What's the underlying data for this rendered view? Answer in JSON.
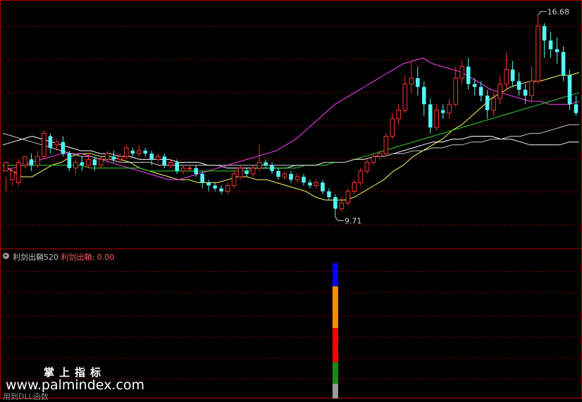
{
  "chart_data": {
    "type": "candlestick",
    "price_min_label": "9.71",
    "price_max_label": "16.68",
    "price_min": 9.71,
    "price_max": 16.68,
    "ylim": [
      8.7,
      17.1
    ],
    "candles": [
      [
        11.3,
        11.6,
        11.1,
        10.6
      ],
      [
        11.0,
        11.3,
        10.9,
        10.8
      ],
      [
        10.9,
        11.6,
        11.7,
        10.8
      ],
      [
        11.5,
        11.8,
        11.8,
        11.4
      ],
      [
        11.7,
        11.5,
        11.9,
        11.3
      ],
      [
        11.5,
        11.8,
        12.0,
        11.4
      ],
      [
        11.8,
        12.6,
        12.7,
        11.7
      ],
      [
        12.5,
        12.1,
        12.6,
        11.9
      ],
      [
        12.2,
        12.3,
        12.4,
        12.0
      ],
      [
        12.3,
        11.9,
        12.5,
        11.8
      ],
      [
        11.9,
        11.4,
        12.0,
        11.3
      ],
      [
        11.4,
        11.6,
        11.7,
        11.2
      ],
      [
        11.6,
        11.5,
        11.8,
        11.3
      ],
      [
        11.5,
        11.7,
        11.9,
        11.4
      ],
      [
        11.7,
        11.5,
        11.8,
        11.3
      ],
      [
        11.5,
        11.7,
        11.8,
        11.4
      ],
      [
        11.7,
        11.9,
        12.0,
        11.6
      ],
      [
        11.8,
        11.7,
        12.0,
        11.6
      ],
      [
        11.7,
        11.8,
        11.9,
        11.6
      ],
      [
        11.8,
        12.1,
        12.2,
        11.7
      ],
      [
        12.0,
        11.9,
        12.1,
        11.8
      ],
      [
        11.9,
        12.0,
        12.2,
        11.8
      ],
      [
        12.0,
        11.9,
        12.1,
        11.8
      ],
      [
        11.9,
        11.7,
        12.0,
        11.5
      ],
      [
        11.7,
        11.8,
        11.9,
        11.6
      ],
      [
        11.8,
        11.5,
        11.9,
        11.4
      ],
      [
        11.5,
        11.6,
        11.7,
        11.4
      ],
      [
        11.6,
        11.3,
        11.7,
        11.2
      ],
      [
        11.3,
        11.4,
        11.5,
        11.2
      ],
      [
        11.4,
        11.4,
        11.5,
        11.3
      ],
      [
        11.4,
        11.2,
        11.5,
        11.1
      ],
      [
        11.2,
        10.9,
        11.3,
        10.7
      ],
      [
        10.9,
        10.8,
        11.0,
        10.6
      ],
      [
        10.8,
        10.7,
        10.9,
        10.6
      ],
      [
        10.7,
        10.6,
        10.8,
        10.5
      ],
      [
        10.6,
        10.8,
        10.9,
        10.5
      ],
      [
        10.8,
        11.2,
        11.3,
        10.7
      ],
      [
        11.1,
        11.4,
        11.5,
        11.0
      ],
      [
        11.3,
        11.2,
        11.4,
        11.1
      ],
      [
        11.2,
        11.4,
        11.5,
        11.1
      ],
      [
        11.4,
        11.6,
        12.2,
        11.3
      ],
      [
        11.6,
        11.5,
        11.7,
        11.4
      ],
      [
        11.5,
        11.3,
        11.6,
        11.2
      ],
      [
        11.3,
        11.1,
        11.4,
        11.0
      ],
      [
        11.1,
        11.2,
        11.3,
        11.0
      ],
      [
        11.2,
        11.0,
        11.3,
        10.9
      ],
      [
        11.0,
        11.1,
        11.2,
        10.9
      ],
      [
        11.1,
        10.9,
        11.2,
        10.8
      ],
      [
        10.9,
        10.8,
        11.0,
        10.7
      ],
      [
        10.8,
        10.9,
        11.0,
        10.7
      ],
      [
        10.9,
        10.6,
        11.0,
        10.5
      ],
      [
        10.6,
        10.4,
        10.7,
        10.3
      ],
      [
        10.4,
        10.0,
        10.5,
        9.71
      ],
      [
        10.0,
        10.2,
        10.4,
        9.9
      ],
      [
        10.2,
        10.6,
        10.7,
        10.1
      ],
      [
        10.6,
        10.9,
        11.0,
        10.5
      ],
      [
        10.9,
        11.3,
        11.4,
        10.8
      ],
      [
        11.3,
        11.6,
        11.7,
        11.2
      ],
      [
        11.6,
        11.8,
        11.9,
        11.5
      ],
      [
        11.8,
        11.9,
        12.0,
        11.7
      ],
      [
        11.9,
        12.5,
        12.6,
        11.8
      ],
      [
        12.5,
        13.1,
        13.3,
        12.4
      ],
      [
        13.1,
        13.4,
        13.6,
        12.9
      ],
      [
        13.4,
        14.3,
        14.6,
        13.3
      ],
      [
        14.3,
        14.5,
        15.1,
        14.0
      ],
      [
        14.5,
        14.2,
        14.9,
        13.9
      ],
      [
        14.2,
        13.6,
        14.4,
        13.2
      ],
      [
        13.6,
        12.8,
        13.8,
        12.6
      ],
      [
        12.8,
        13.4,
        13.6,
        12.7
      ],
      [
        13.4,
        13.3,
        13.6,
        13.1
      ],
      [
        13.3,
        13.6,
        13.8,
        13.1
      ],
      [
        13.6,
        14.5,
        14.9,
        13.5
      ],
      [
        14.5,
        14.9,
        15.1,
        14.3
      ],
      [
        14.9,
        14.3,
        15.2,
        14.1
      ],
      [
        14.3,
        14.2,
        14.5,
        13.9
      ],
      [
        14.2,
        13.9,
        14.4,
        13.7
      ],
      [
        13.9,
        13.4,
        14.1,
        13.1
      ],
      [
        13.4,
        13.8,
        14.0,
        13.2
      ],
      [
        13.8,
        14.3,
        14.6,
        13.6
      ],
      [
        14.3,
        14.8,
        15.4,
        14.1
      ],
      [
        14.8,
        14.4,
        15.1,
        14.2
      ],
      [
        14.4,
        14.1,
        14.7,
        13.9
      ],
      [
        14.1,
        13.9,
        14.3,
        13.6
      ],
      [
        13.9,
        14.4,
        14.9,
        13.7
      ],
      [
        14.4,
        16.3,
        16.68,
        14.3
      ],
      [
        16.3,
        15.8,
        16.4,
        15.2
      ],
      [
        15.8,
        15.5,
        16.1,
        15.2
      ],
      [
        15.5,
        15.4,
        15.9,
        15.0
      ],
      [
        15.4,
        14.6,
        15.6,
        14.4
      ],
      [
        14.6,
        13.6,
        14.8,
        13.4
      ],
      [
        13.6,
        13.3,
        13.9,
        13.2
      ]
    ],
    "ma_lines": [
      {
        "color": "#ffffff",
        "values": [
          12.2,
          12.3,
          12.4,
          12.5,
          12.4,
          12.3,
          12.2,
          12.1,
          12.0,
          12.0,
          11.9,
          11.9,
          11.8,
          11.8,
          11.7,
          11.7,
          11.7,
          11.7,
          11.6,
          11.6,
          11.6,
          11.5,
          11.5,
          11.4,
          11.4,
          11.4,
          11.4,
          11.4,
          11.4,
          11.4,
          11.5,
          11.5,
          11.5,
          11.6,
          11.6,
          11.6,
          11.7,
          11.7,
          11.8,
          11.8,
          11.9,
          12.0,
          12.1,
          12.2,
          12.3,
          12.3,
          12.4,
          12.4,
          12.5,
          12.5,
          12.5,
          12.4,
          12.4,
          12.3,
          12.2,
          12.2,
          12.2,
          12.2,
          12.3,
          12.3
        ]
      },
      {
        "color": "#ffff66",
        "values": [
          11.5,
          11.3,
          11.1,
          11.1,
          11.3,
          11.5,
          11.6,
          11.8,
          11.9,
          11.9,
          11.8,
          11.8,
          11.7,
          11.6,
          11.4,
          11.3,
          11.2,
          11.1,
          11.0,
          11.0,
          10.9,
          10.9,
          10.9,
          11.0,
          11.1,
          11.1,
          11.0,
          11.0,
          10.9,
          10.8,
          10.7,
          10.6,
          10.4,
          10.3,
          10.3,
          10.3,
          10.4,
          10.6,
          10.8,
          11.0,
          11.3,
          11.5,
          11.8,
          12.0,
          12.2,
          12.4,
          12.7,
          12.9,
          13.2,
          13.5,
          13.8,
          14.0,
          14.2,
          14.3,
          14.4,
          14.4,
          14.5,
          14.6,
          14.6,
          14.7
        ]
      },
      {
        "color": "#ff44ff",
        "values": [
          11.3,
          11.4,
          11.5,
          11.6,
          11.7,
          11.8,
          11.9,
          11.9,
          11.9,
          11.8,
          11.7,
          11.6,
          11.5,
          11.4,
          11.3,
          11.2,
          11.1,
          11.0,
          11.0,
          11.1,
          11.2,
          11.3,
          11.4,
          11.5,
          11.6,
          11.7,
          11.8,
          11.9,
          12.0,
          12.2,
          12.4,
          12.7,
          13.0,
          13.3,
          13.6,
          13.8,
          14.0,
          14.2,
          14.4,
          14.6,
          14.8,
          15.0,
          15.1,
          15.2,
          15.0,
          14.9,
          14.8,
          14.7,
          14.5,
          14.3,
          14.1,
          14.0,
          13.9,
          13.8,
          13.7,
          13.7,
          13.6,
          13.6,
          13.6,
          13.7
        ]
      },
      {
        "color": "#2fd82f",
        "values": [
          11.5,
          11.5,
          11.5,
          11.5,
          11.5,
          11.5,
          11.5,
          11.5,
          11.5,
          11.4,
          11.4,
          11.4,
          11.4,
          11.4,
          11.4,
          11.3,
          11.3,
          11.3,
          11.3,
          11.3,
          11.3,
          11.3,
          11.3,
          11.3,
          11.3,
          11.3,
          11.4,
          11.4,
          11.4,
          11.4,
          11.4,
          11.5,
          11.5,
          11.5,
          11.6,
          11.6,
          11.7,
          11.8,
          11.9,
          12.0,
          12.1,
          12.2,
          12.3,
          12.4,
          12.5,
          12.6,
          12.7,
          12.8,
          12.9,
          13.0,
          13.1,
          13.2,
          13.3,
          13.4,
          13.5,
          13.6,
          13.7,
          13.8,
          13.9,
          14.0
        ]
      },
      {
        "color": "#c8c8c8",
        "values": [
          12.6,
          12.5,
          12.4,
          12.3,
          12.2,
          12.1,
          12.0,
          11.9,
          11.8,
          11.8,
          11.7,
          11.7,
          11.6,
          11.6,
          11.6,
          11.6,
          11.5,
          11.5,
          11.5,
          11.5,
          11.5,
          11.5,
          11.5,
          11.5,
          11.5,
          11.5,
          11.5,
          11.5,
          11.5,
          11.5,
          11.5,
          11.5,
          11.5,
          11.6,
          11.6,
          11.6,
          11.7,
          11.7,
          11.8,
          11.8,
          11.9,
          11.9,
          12.0,
          12.0,
          12.1,
          12.1,
          12.2,
          12.2,
          12.3,
          12.3,
          12.4,
          12.4,
          12.5,
          12.5,
          12.6,
          12.6,
          12.7,
          12.8,
          12.9,
          12.9
        ]
      }
    ],
    "indicator": {
      "name": "利剑出鞘520",
      "value_label": "利剑出鞘: 0.00",
      "bar_segments": [
        {
          "color": "#0000ff",
          "fraction": 0.17
        },
        {
          "color": "#ff8c00",
          "fraction": 0.31
        },
        {
          "color": "#ff0000",
          "fraction": 0.25
        },
        {
          "color": "#1a8a1a",
          "fraction": 0.16
        },
        {
          "color": "#9a9a9a",
          "fraction": 0.11
        }
      ],
      "bar_index": 52
    }
  },
  "watermark": {
    "title": "掌上指标",
    "url": "www.palmindex.com"
  },
  "bottom_text": "用到DLL函数",
  "colors": {
    "up": "#ff3232",
    "down": "#54f6f6",
    "grid": "#8b0000",
    "frame": "#b00000"
  }
}
